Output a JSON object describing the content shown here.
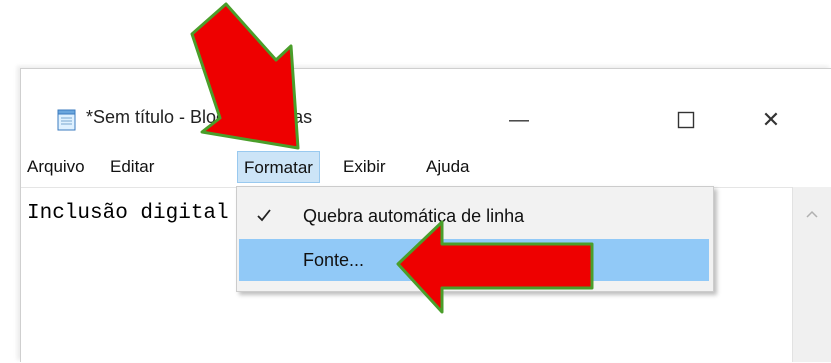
{
  "window": {
    "title": "*Sem título - Bloco de Notas",
    "minimize_glyph": "—",
    "close_glyph": "✕"
  },
  "menubar": {
    "items": [
      "Arquivo",
      "Editar",
      "Formatar",
      "Exibir",
      "Ajuda"
    ],
    "active_index": 2
  },
  "editor": {
    "text": "Inclusão digital"
  },
  "format_menu": {
    "items": [
      {
        "label": "Quebra automática de linha",
        "checked": true
      },
      {
        "label": "Fonte...",
        "checked": false,
        "highlighted": true
      }
    ]
  },
  "colors": {
    "arrow_fill": "#ee0000",
    "arrow_stroke": "#4a9e2a",
    "menu_highlight": "#91c9f7",
    "active_menu": "#cce4f7"
  }
}
